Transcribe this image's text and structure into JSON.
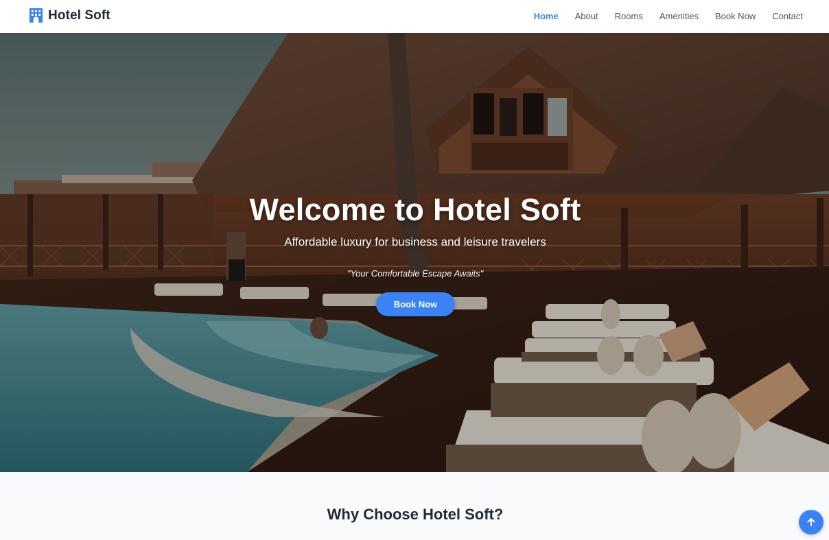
{
  "nav": {
    "brand": "Hotel Soft",
    "brand_icon": "hotel-building-icon",
    "links": [
      "Home",
      "About",
      "Rooms",
      "Amenities",
      "Book Now",
      "Contact"
    ],
    "active": "Home"
  },
  "hero": {
    "title": "Welcome to Hotel Soft",
    "subtitle": "Affordable luxury for business and leisure travelers",
    "tagline": "\"Your Comfortable Escape Awaits\"",
    "cta": "Book Now"
  },
  "features": {
    "title": "Why Choose Hotel Soft?"
  },
  "scroll_top_icon": "arrow-up-icon",
  "colors": {
    "accent": "#3b82f6",
    "text_dark": "#1f2937",
    "nav_text": "#4b5563",
    "section_bg": "#f8fafc"
  }
}
